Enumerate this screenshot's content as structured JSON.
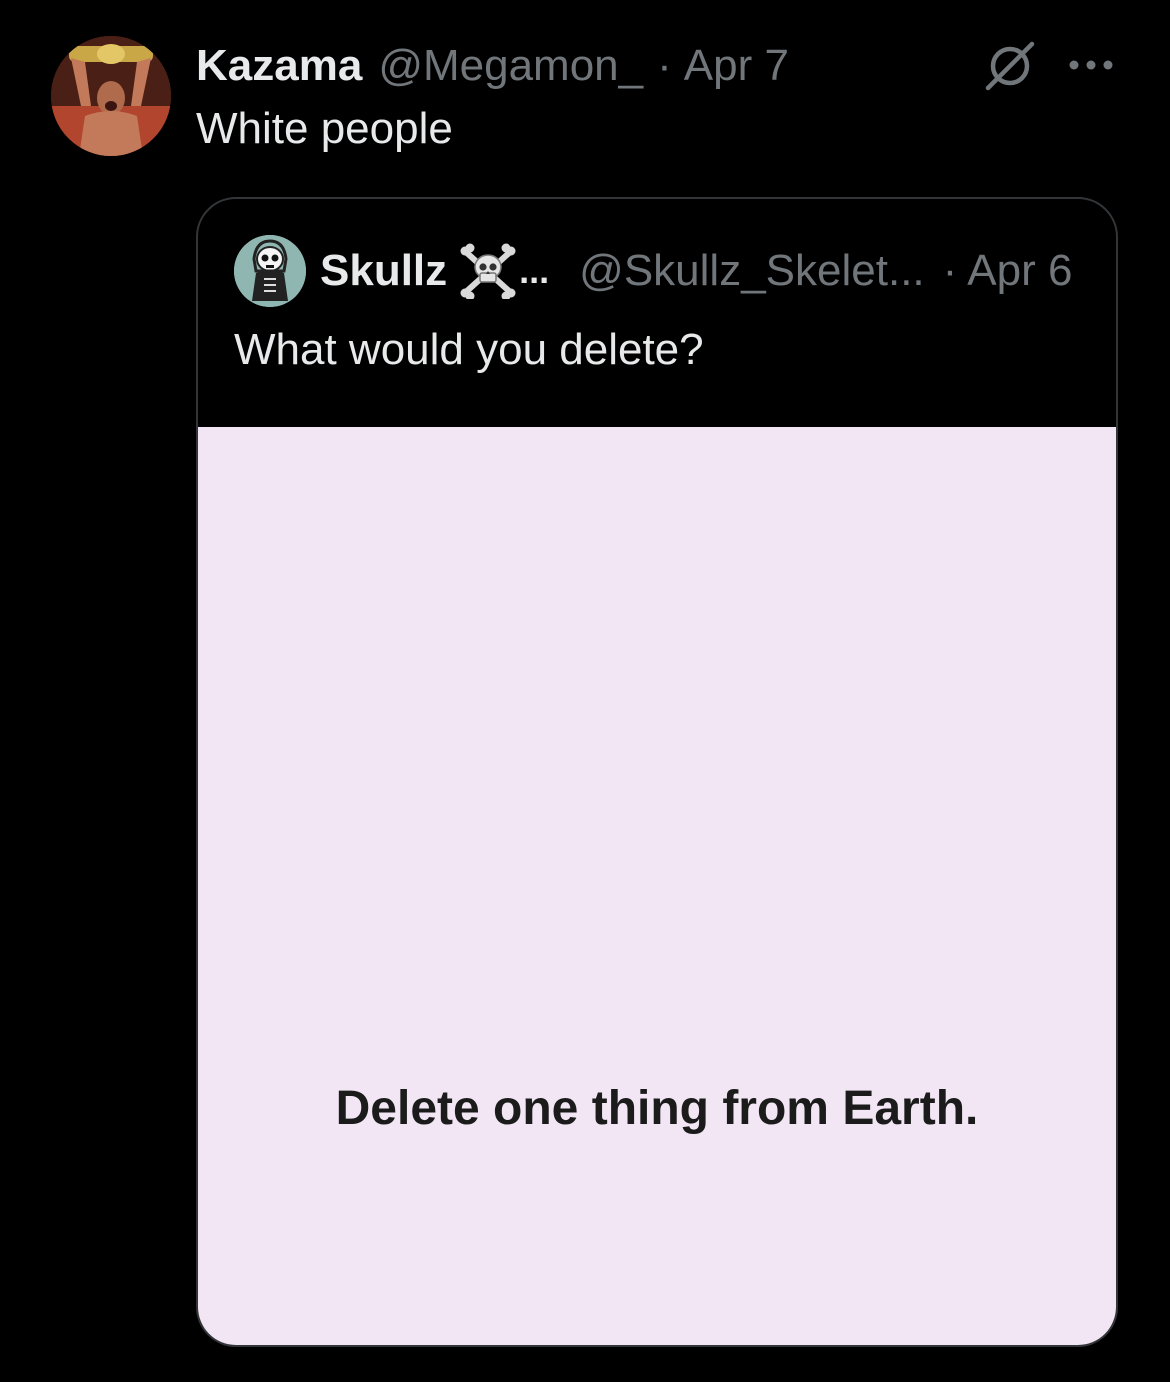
{
  "tweet": {
    "author": {
      "name": "Kazama",
      "handle": "@Megamon_",
      "avatar": "wrestler-champion-avatar"
    },
    "separator": "·",
    "date": "Apr 7",
    "text": "White people",
    "icons": {
      "grok": "grok-icon",
      "more": "more-icon"
    }
  },
  "quote": {
    "author": {
      "name": "Skullz",
      "emoji": "skull-crossbones-emoji",
      "truncation": "...",
      "handle": "@Skullz_Skelet...",
      "avatar": "skeleton-avatar"
    },
    "separator": "·",
    "date": "Apr 6",
    "text": "What would you delete?",
    "image": {
      "caption": "Delete one thing from Earth.",
      "background": "#f2e6f4"
    }
  },
  "colors": {
    "background": "#000000",
    "text_primary": "#e7e9ea",
    "text_secondary": "#71767b",
    "border": "#333639"
  }
}
